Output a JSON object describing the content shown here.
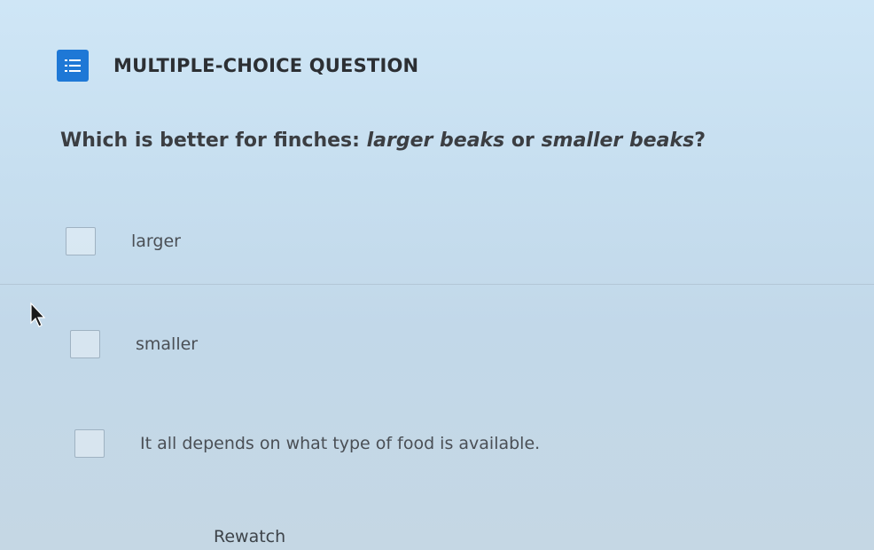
{
  "header": {
    "type_icon": "list-icon",
    "type_label": "MULTIPLE-CHOICE QUESTION"
  },
  "question": {
    "prefix": "Which is better for finches: ",
    "option_a": "larger beaks",
    "middle": " or ",
    "option_b": "smaller beaks",
    "suffix": "?"
  },
  "options": [
    {
      "label": "larger",
      "checked": false
    },
    {
      "label": "smaller",
      "checked": false
    },
    {
      "label": "It all depends on what type of food is available.",
      "checked": false
    }
  ],
  "actions": {
    "rewatch_label": "Rewatch"
  },
  "colors": {
    "accent": "#1e78d6",
    "background": "#c7dff0"
  }
}
